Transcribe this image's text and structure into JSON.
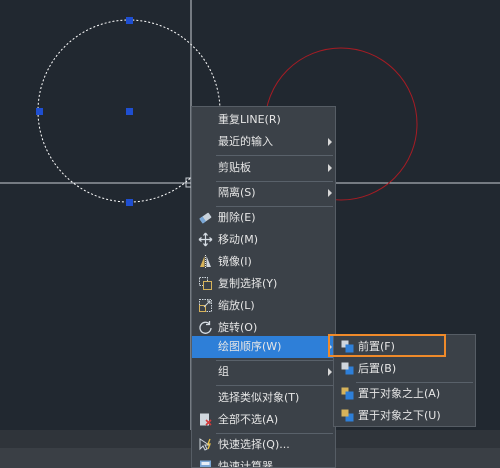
{
  "context_menu": {
    "items": [
      {
        "label": "重复LINE(R)",
        "icon": "",
        "submenu": false
      },
      {
        "label": "最近的输入",
        "icon": "",
        "submenu": true
      },
      {
        "label": "剪贴板",
        "icon": "",
        "submenu": true
      },
      {
        "label": "隔离(S)",
        "icon": "",
        "submenu": true
      },
      {
        "label": "删除(E)",
        "icon": "eraser-icon",
        "submenu": false
      },
      {
        "label": "移动(M)",
        "icon": "move-icon",
        "submenu": false
      },
      {
        "label": "镜像(I)",
        "icon": "mirror-icon",
        "submenu": false
      },
      {
        "label": "复制选择(Y)",
        "icon": "copy-selection-icon",
        "submenu": false
      },
      {
        "label": "缩放(L)",
        "icon": "scale-icon",
        "submenu": false
      },
      {
        "label": "旋转(O)",
        "icon": "rotate-icon",
        "submenu": false
      },
      {
        "label": "绘图顺序(W)",
        "icon": "",
        "submenu": true,
        "active": true
      },
      {
        "label": "组",
        "icon": "",
        "submenu": true
      },
      {
        "label": "选择类似对象(T)",
        "icon": "",
        "submenu": false
      },
      {
        "label": "全部不选(A)",
        "icon": "deselect-all-icon",
        "submenu": false
      },
      {
        "label": "快速选择(Q)...",
        "icon": "quick-select-icon",
        "submenu": false
      },
      {
        "label": "快速计算器",
        "icon": "calculator-icon",
        "submenu": false
      }
    ]
  },
  "draw_order_submenu": {
    "items": [
      {
        "label": "前置(F)",
        "icon": "bring-to-front-icon"
      },
      {
        "label": "后置(B)",
        "icon": "send-to-back-icon"
      },
      {
        "label": "置于对象之上(A)",
        "icon": "bring-above-objects-icon"
      },
      {
        "label": "置于对象之下(U)",
        "icon": "send-under-objects-icon"
      }
    ]
  },
  "colors": {
    "canvas_bg": "#212830",
    "selected_circle": "#ffffff",
    "grip": "#1f4fd1",
    "red_circle": "#a61c24",
    "highlight_outline": "#ef8a2a",
    "menu_active": "#2e7fd8"
  }
}
